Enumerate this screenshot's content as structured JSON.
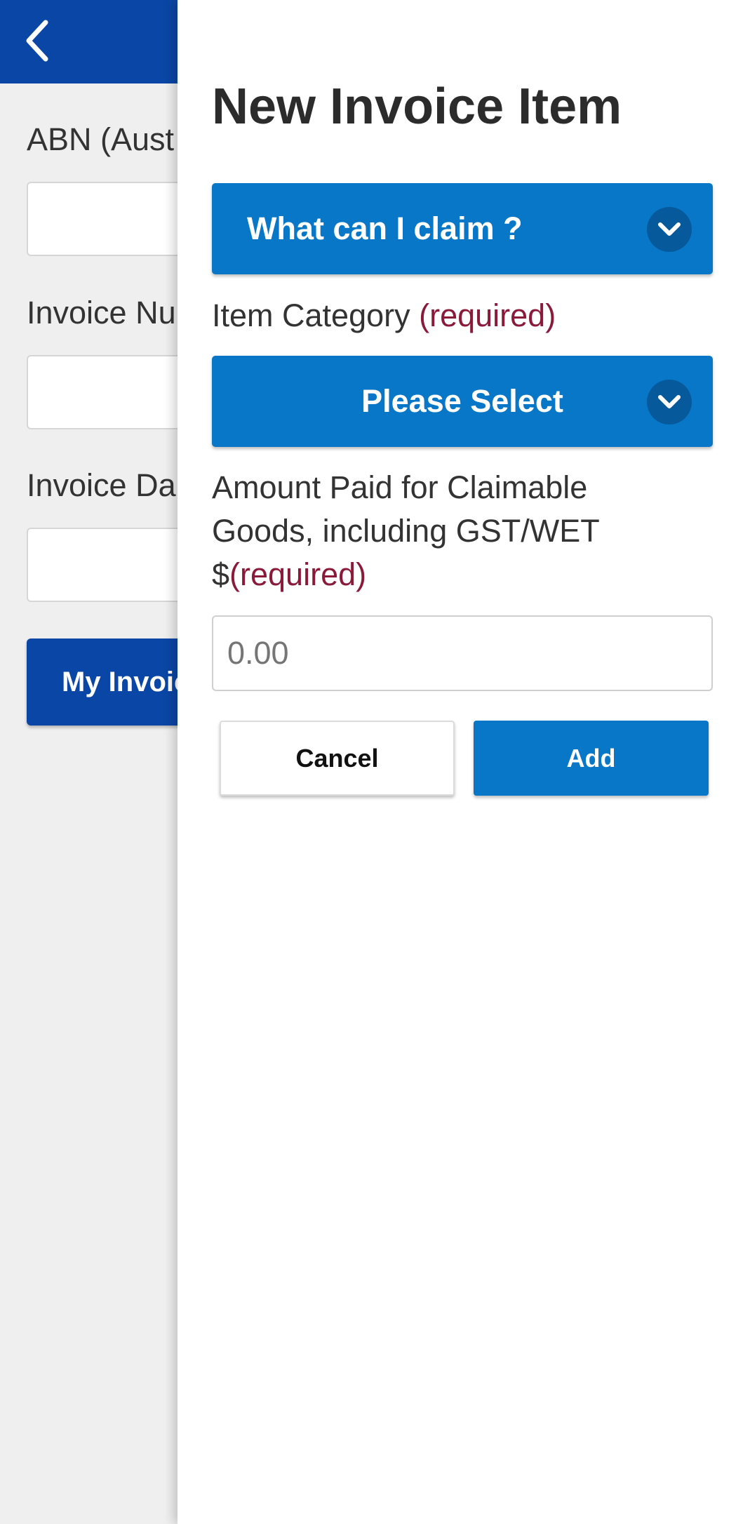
{
  "background_page": {
    "fields": [
      {
        "label": "ABN (Aust"
      },
      {
        "label": "Invoice Nu"
      },
      {
        "label": "Invoice Da"
      }
    ],
    "primary_button_label": "My Invoic",
    "header_color": "#0a46a5"
  },
  "drawer": {
    "title": "New Invoice Item",
    "claim_accordion_label": "What can I claim ?",
    "category": {
      "label": "Item Category ",
      "required": "(required)",
      "selected": "Please Select"
    },
    "amount": {
      "label": "Amount Paid for Claimable Goods, including GST/WET $",
      "required": "(required)",
      "placeholder": "0.00"
    },
    "cancel_label": "Cancel",
    "add_label": "Add"
  },
  "icons": {
    "back": "chevron-left-icon",
    "expand": "chevron-down-icon"
  },
  "colors": {
    "accent": "#0877c8",
    "header": "#0a46a5",
    "required": "#8b1a3a"
  }
}
